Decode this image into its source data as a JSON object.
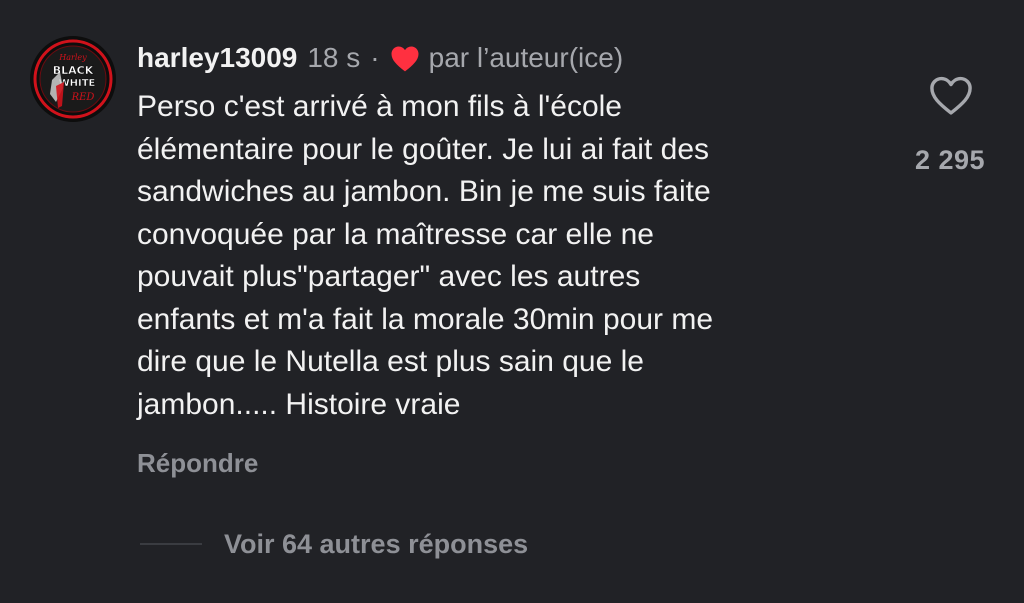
{
  "comment": {
    "avatar_icon": "black-white-red-logo-avatar",
    "avatar_logo_text": [
      "Harley",
      "BLACK",
      "WHITE",
      "RED"
    ],
    "username": "harley13009",
    "timestamp": "18 s",
    "separator": "·",
    "author_like_icon": "red-heart-icon",
    "author_like_text": "par l’auteur(ice)",
    "text": "Perso c'est arrivé à mon fils à l'école\nélémentaire pour le goûter. Je lui ai fait des\nsandwiches au jambon. Bin je me suis faite\nconvoquée par la maîtresse car elle ne\npouvait plus\"partager\" avec les autres\nenfants et m'a fait la morale 30min pour me\ndire que le Nutella est plus sain que le\njambon..... Histoire vraie",
    "reply_label": "Répondre",
    "like_icon": "heart-outline-icon",
    "like_count": "2 295",
    "view_replies_label": "Voir 64 autres réponses"
  },
  "colors": {
    "background": "#212226",
    "primary_text": "#f2f2f2",
    "secondary_text": "#a6a8ad",
    "heart_red": "#ff3040"
  }
}
